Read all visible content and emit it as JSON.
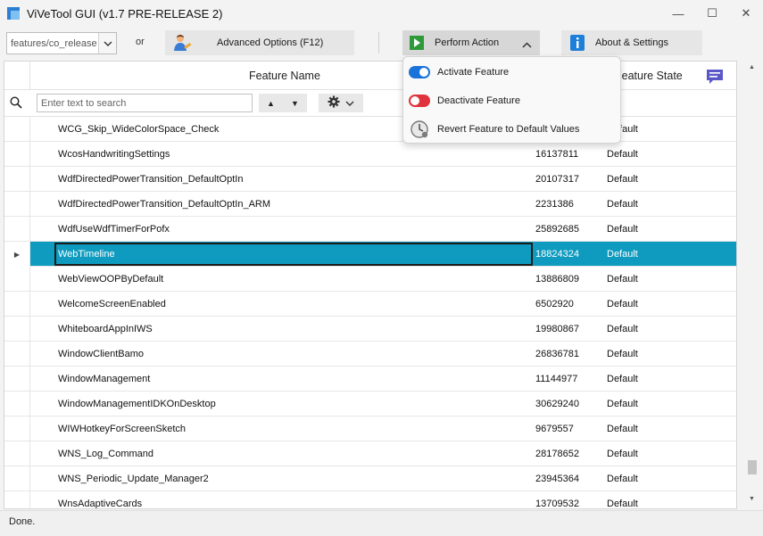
{
  "window": {
    "title": "ViVeTool GUI (v1.7 PRE-RELEASE 2)",
    "minimize_glyph": "—",
    "maximize_glyph": "☐",
    "close_glyph": "✕"
  },
  "toolbar": {
    "branch_value": "features/co_release",
    "or_label": "or",
    "advanced_label": "Advanced Options (F12)",
    "perform_label": "Perform Action",
    "about_label": "About & Settings"
  },
  "grid": {
    "columns": {
      "name": "Feature Name",
      "state": "Feature State"
    },
    "filter": {
      "placeholder": "Enter text to search",
      "value": ""
    },
    "rows": [
      {
        "name": "WCG_Skip_WideColorSpace_Check",
        "id": "",
        "state": "Default"
      },
      {
        "name": "WcosHandwritingSettings",
        "id": "16137811",
        "state": "Default"
      },
      {
        "name": "WdfDirectedPowerTransition_DefaultOptIn",
        "id": "20107317",
        "state": "Default"
      },
      {
        "name": "WdfDirectedPowerTransition_DefaultOptIn_ARM",
        "id": "2231386",
        "state": "Default"
      },
      {
        "name": "WdfUseWdfTimerForPofx",
        "id": "25892685",
        "state": "Default"
      },
      {
        "name": "WebTimeline",
        "id": "18824324",
        "state": "Default",
        "selected": true
      },
      {
        "name": "WebViewOOPByDefault",
        "id": "13886809",
        "state": "Default"
      },
      {
        "name": "WelcomeScreenEnabled",
        "id": "6502920",
        "state": "Default"
      },
      {
        "name": "WhiteboardAppInIWS",
        "id": "19980867",
        "state": "Default"
      },
      {
        "name": "WindowClientBamo",
        "id": "26836781",
        "state": "Default"
      },
      {
        "name": "WindowManagement",
        "id": "11144977",
        "state": "Default"
      },
      {
        "name": "WindowManagementIDKOnDesktop",
        "id": "30629240",
        "state": "Default"
      },
      {
        "name": "WIWHotkeyForScreenSketch",
        "id": "9679557",
        "state": "Default"
      },
      {
        "name": "WNS_Log_Command",
        "id": "28178652",
        "state": "Default"
      },
      {
        "name": "WNS_Periodic_Update_Manager2",
        "id": "23945364",
        "state": "Default"
      },
      {
        "name": "WnsAdaptiveCards",
        "id": "13709532",
        "state": "Default"
      }
    ]
  },
  "menu": {
    "items": [
      {
        "label": "Activate Feature",
        "icon": "toggle-on-icon"
      },
      {
        "label": "Deactivate Feature",
        "icon": "toggle-off-icon"
      },
      {
        "label": "Revert Feature to Default Values",
        "icon": "clock-icon"
      }
    ]
  },
  "status": {
    "text": "Done."
  },
  "colors": {
    "selection": "#0e9bbf",
    "toggle_on": "#1a73d9",
    "toggle_off": "#e0323c",
    "play_green": "#2f9a3a",
    "info_blue": "#1e7fd8",
    "chat_purple": "#5b57c9"
  }
}
